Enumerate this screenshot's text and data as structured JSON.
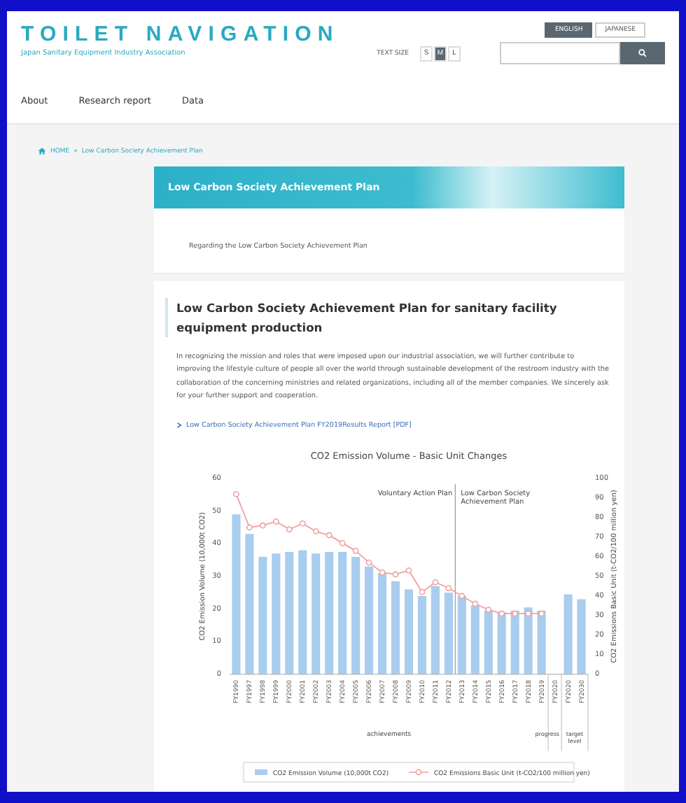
{
  "header": {
    "logo": "TOILET NAVIGATION",
    "subtitle": "Japan Sanitary Equipment Industry Association",
    "languages": [
      {
        "label": "ENGLISH",
        "selected": true
      },
      {
        "label": "JAPANESE",
        "selected": false
      }
    ],
    "text_size": {
      "label": "TEXT SIZE",
      "options": [
        {
          "label": "S",
          "selected": false
        },
        {
          "label": "M",
          "selected": true
        },
        {
          "label": "L",
          "selected": false
        }
      ]
    }
  },
  "nav": [
    "About",
    "Research report",
    "Data"
  ],
  "breadcrumb": {
    "items": [
      "HOME",
      "Low Carbon Society Achievement Plan"
    ],
    "separator": "»"
  },
  "page_title": "Low Carbon Society Achievement Plan",
  "sub_links": [
    "Regarding the Low Carbon Society Achievement Plan"
  ],
  "heading": "Low Carbon Society Achievement Plan for sanitary facility equipment production",
  "paragraph": "In recognizing the mission and roles that were imposed upon our industrial association, we will further contribute to improving the lifestyle culture of people all over the world through sustainable development of the restroom industry with the collaboration of the concerning ministries and related organizations, including all of the member companies. We sincerely ask for your further support and cooperation.",
  "report_link": "Low Carbon Society Achievement Plan FY2019Results Report [PDF]",
  "chart": {
    "category_groups": [
      "achievements",
      "progress",
      "target level"
    ],
    "chart_data": {
      "type": "bar",
      "title": "CO2 Emission Volume - Basic Unit Changes",
      "ylabel": "CO2 Emission Volume (10,000t CO2)",
      "categories": [
        "FY1990",
        "FY1997",
        "FY1998",
        "FY1999",
        "FY2000",
        "FY2001",
        "FY2002",
        "FY2003",
        "FY2004",
        "FY2005",
        "FY2006",
        "FY2007",
        "FY2008",
        "FY2009",
        "FY2010",
        "FY2011",
        "FY2012",
        "FY2013",
        "FY2014",
        "FY2015",
        "FY2016",
        "FY2017",
        "FY2018",
        "FY2019",
        "FY2020",
        "FY2020",
        "FY2030"
      ],
      "ylim": [
        0,
        60
      ],
      "yticks": [
        0,
        10,
        20,
        30,
        40,
        50,
        60
      ],
      "series": [
        {
          "name": "CO2 Emission Volume (10,000t CO2)",
          "color": "#a9cdee",
          "values": [
            49,
            43,
            36,
            37,
            37.5,
            38,
            37,
            37.5,
            37.5,
            36,
            33,
            31,
            28.5,
            26,
            24,
            27,
            25,
            24,
            21,
            19.5,
            19,
            19.5,
            20.5,
            19.5,
            null,
            24.5,
            23
          ]
        }
      ],
      "annotations": [
        "Voluntary Action Plan",
        "Low Carbon Society Achievement Plan"
      ]
    },
    "line_overlay": {
      "chart_data": {
        "type": "line",
        "ylabel": "CO2 Emissions Basic Unit (t-CO2/100 million yen)",
        "ylim": [
          0,
          100
        ],
        "yticks": [
          100,
          90,
          80,
          70,
          60,
          50,
          40,
          30,
          20,
          10,
          0
        ],
        "series": [
          {
            "name": "CO2 Emissions Basic Unit (t-CO2/100 million yen)",
            "color": "#f0a0a0",
            "marker": "circle",
            "values": [
              92,
              75,
              76,
              78,
              74,
              77,
              73,
              71,
              67,
              63,
              57,
              52,
              51,
              53,
              42,
              47,
              44,
              40,
              36,
              33,
              31,
              31,
              31,
              31,
              null,
              null,
              null
            ]
          }
        ]
      }
    }
  }
}
